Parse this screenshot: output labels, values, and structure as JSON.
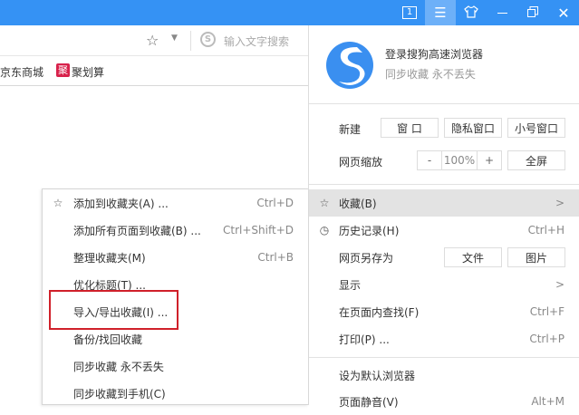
{
  "titlebar": {
    "tab_count": "1",
    "icons": [
      "tab-count-icon",
      "menu-icon",
      "skin-icon",
      "minimize-icon",
      "restore-icon",
      "close-icon"
    ]
  },
  "toolbar": {
    "search_placeholder": "输入文字搜索"
  },
  "bookmarks": [
    {
      "label": "京东商城"
    },
    {
      "label": "聚划算",
      "badge": "聚"
    }
  ],
  "menu": {
    "login_title": "登录搜狗高速浏览器",
    "login_sub": "同步收藏 永不丢失",
    "new_label": "新建",
    "new_buttons": [
      "窗 口",
      "隐私窗口",
      "小号窗口"
    ],
    "zoom_label": "网页缩放",
    "zoom_minus": "-",
    "zoom_value": "100%",
    "zoom_plus": "+",
    "fullscreen": "全屏",
    "items": [
      {
        "label": "收藏(B)",
        "shortcut": ">"
      },
      {
        "label": "历史记录(H)",
        "shortcut": "Ctrl+H"
      },
      {
        "label": "网页另存为",
        "buttons": [
          "文件",
          "图片"
        ]
      },
      {
        "label": "显示",
        "shortcut": ">"
      },
      {
        "label": "在页面内查找(F)",
        "shortcut": "Ctrl+F"
      },
      {
        "label": "打印(P) ...",
        "shortcut": "Ctrl+P"
      },
      {
        "label": "设为默认浏览器",
        "shortcut": ""
      },
      {
        "label": "页面静音(V)",
        "shortcut": "Alt+M"
      }
    ]
  },
  "submenu": {
    "items": [
      {
        "label": "添加到收藏夹(A) ...",
        "shortcut": "Ctrl+D"
      },
      {
        "label": "添加所有页面到收藏(B) ...",
        "shortcut": "Ctrl+Shift+D"
      },
      {
        "label": "整理收藏夹(M)",
        "shortcut": "Ctrl+B"
      },
      {
        "label": "优化标题(T) ...",
        "shortcut": ""
      },
      {
        "label": "导入/导出收藏(I) ...",
        "shortcut": ""
      },
      {
        "label": "备份/找回收藏",
        "shortcut": ""
      },
      {
        "label": "同步收藏 永不丢失",
        "shortcut": ""
      },
      {
        "label": "同步收藏到手机(C)",
        "shortcut": ""
      }
    ]
  },
  "colors": {
    "titlebar": "#3592f4",
    "highlight": "#e3e3e3",
    "annotation": "#d0202a"
  }
}
